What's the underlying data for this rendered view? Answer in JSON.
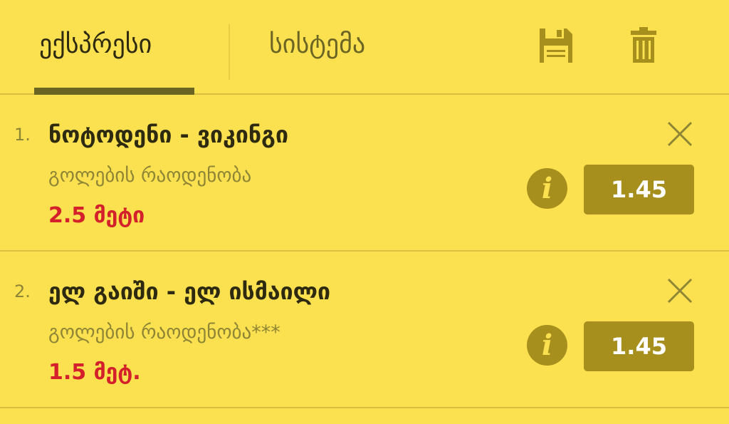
{
  "tabs": {
    "express": "ექსპრესი",
    "system": "სისტემა"
  },
  "toolbar": {
    "save_icon": "save-icon",
    "trash_icon": "trash-icon"
  },
  "bets": [
    {
      "index": "1.",
      "title": "ნოტოდენი - ვიკინგი",
      "market": "გოლების რაოდენობა",
      "pick": "2.5 მეტი",
      "odds": "1.45",
      "info_label": "i"
    },
    {
      "index": "2.",
      "title": "ელ გაიში - ელ ისმაილი",
      "market": "გოლების რაოდენობა***",
      "pick": "1.5 მეტ.",
      "odds": "1.45",
      "info_label": "i"
    }
  ],
  "colors": {
    "background": "#FBE050",
    "accent": "#A68F1D",
    "pick_red": "#D3202A",
    "text_dark": "#2E2A10",
    "text_muted": "#8E8535"
  }
}
